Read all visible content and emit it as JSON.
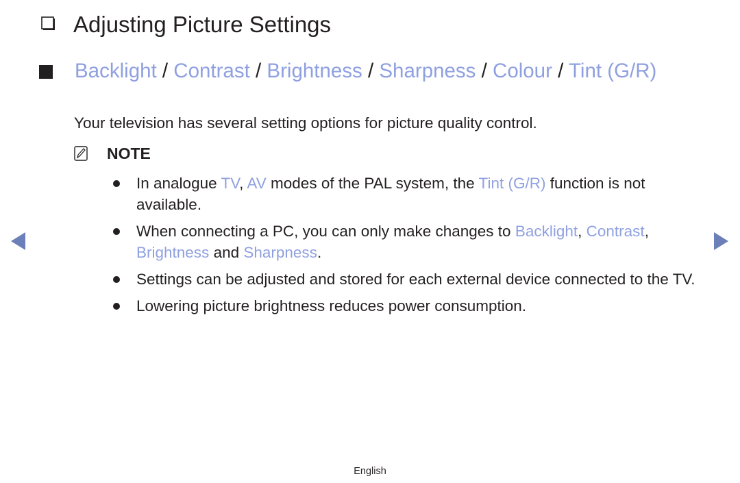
{
  "heading": {
    "icon": "checkbox-outline-icon",
    "title": "Adjusting Picture Settings"
  },
  "section": {
    "icon": "filled-square-icon",
    "items": [
      "Backlight",
      "Contrast",
      "Brightness",
      "Sharpness",
      "Colour",
      "Tint (G/R)"
    ],
    "separator": " / ",
    "accent_color": "#8fa0e0"
  },
  "intro": "Your television has several setting options for picture quality control.",
  "note": {
    "icon": "note-pencil-icon",
    "label": "NOTE"
  },
  "bullets": [
    {
      "parts": [
        {
          "text": "In analogue "
        },
        {
          "text": "TV",
          "hl": true
        },
        {
          "text": ", "
        },
        {
          "text": "AV",
          "hl": true
        },
        {
          "text": " modes of the PAL system, the "
        },
        {
          "text": "Tint (G/R)",
          "hl": true
        },
        {
          "text": " function is not available."
        }
      ]
    },
    {
      "parts": [
        {
          "text": "When connecting a PC, you can only make changes to "
        },
        {
          "text": "Backlight",
          "hl": true
        },
        {
          "text": ", "
        },
        {
          "text": "Contrast",
          "hl": true
        },
        {
          "text": ", "
        },
        {
          "text": "Brightness",
          "hl": true
        },
        {
          "text": " and "
        },
        {
          "text": "Sharpness",
          "hl": true
        },
        {
          "text": "."
        }
      ]
    },
    {
      "parts": [
        {
          "text": "Settings can be adjusted and stored for each external device connected to the TV."
        }
      ]
    },
    {
      "parts": [
        {
          "text": "Lowering picture brightness reduces power consumption."
        }
      ]
    }
  ],
  "nav": {
    "previous_icon": "triangle-left-icon",
    "next_icon": "triangle-right-icon",
    "color": "#6b7fb8"
  },
  "footer": {
    "language": "English"
  }
}
